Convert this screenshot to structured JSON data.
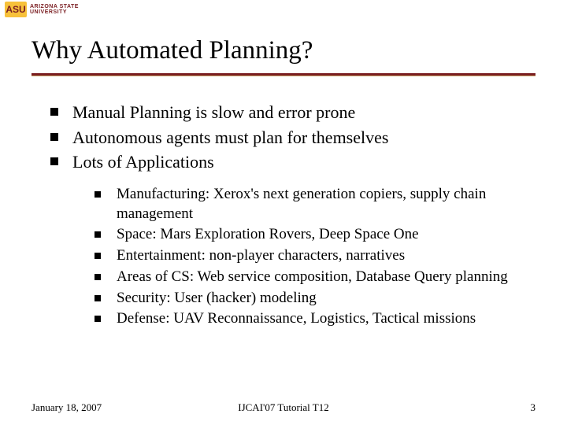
{
  "logo": {
    "mark": "ASU",
    "line1": "ARIZONA STATE",
    "line2": "UNIVERSITY"
  },
  "title": "Why Automated Planning?",
  "bullets": [
    "Manual Planning is slow and error prone",
    "Autonomous agents must plan for themselves",
    "Lots of Applications"
  ],
  "sub_bullets": [
    "Manufacturing: Xerox's next generation copiers, supply chain management",
    "Space: Mars Exploration Rovers, Deep Space One",
    "Entertainment: non-player characters, narratives",
    "Areas of CS: Web service composition, Database Query planning",
    "Security: User (hacker) modeling",
    "Defense: UAV Reconnaissance, Logistics, Tactical missions"
  ],
  "footer": {
    "date": "January 18, 2007",
    "center": "IJCAI'07 Tutorial T12",
    "page": "3"
  }
}
